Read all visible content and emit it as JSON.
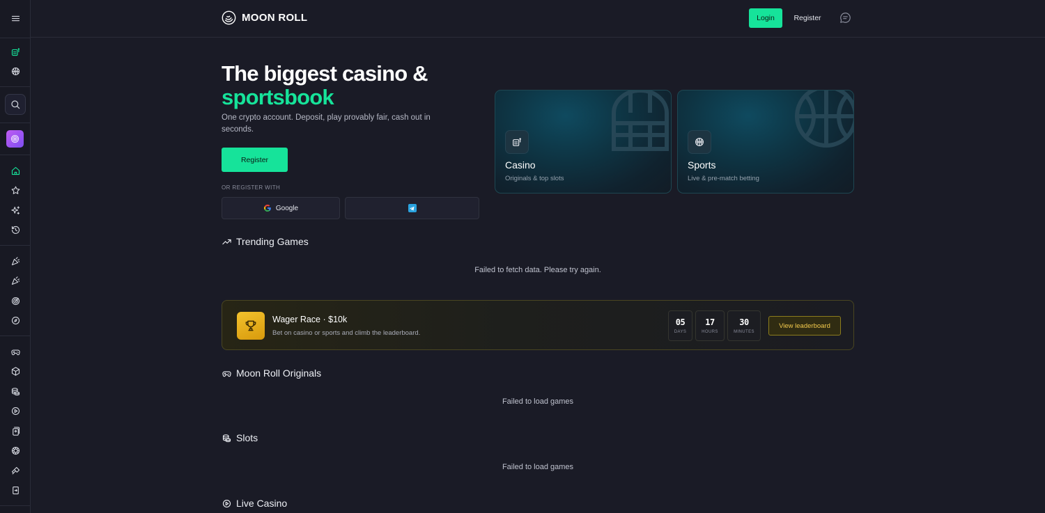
{
  "brand": {
    "name": "MOON ROLL"
  },
  "header": {
    "login_label": "Login",
    "register_label": "Register"
  },
  "hero": {
    "title_line1": "The biggest casino &",
    "title_line2": "sportsbook",
    "subtitle": "One crypto account. Deposit, play provably fair, cash out in seconds.",
    "register_label": "Register",
    "or_register_with": "OR REGISTER WITH",
    "google_label": "Google"
  },
  "cards": [
    {
      "title": "Casino",
      "subtitle": "Originals & top slots",
      "icon": "slot-machine-icon"
    },
    {
      "title": "Sports",
      "subtitle": "Live & pre-match betting",
      "icon": "basketball-icon"
    }
  ],
  "trending": {
    "title": "Trending Games",
    "message": "Failed to fetch data. Please try again."
  },
  "wager": {
    "title": "Wager Race · $10k",
    "subtitle": "Bet on casino or sports and climb the leaderboard.",
    "countdown": [
      {
        "value": "05",
        "label": "DAYS"
      },
      {
        "value": "17",
        "label": "HOURS"
      },
      {
        "value": "30",
        "label": "MINUTES"
      }
    ],
    "button_label": "View leaderboard"
  },
  "originals": {
    "title": "Moon Roll Originals",
    "message": "Failed to load games"
  },
  "slots": {
    "title": "Slots",
    "message": "Failed to load games"
  },
  "live_casino": {
    "title": "Live Casino"
  },
  "colors": {
    "accent": "#16e39a",
    "background": "#1a1b26",
    "gold": "#f2c94c"
  }
}
